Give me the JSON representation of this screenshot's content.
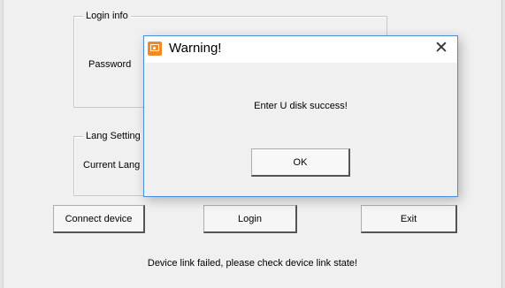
{
  "login_group": {
    "title": "Login info",
    "password_label": "Password"
  },
  "lang_group": {
    "title": "Lang Setting",
    "current_lang_label": "Current Lang"
  },
  "buttons": {
    "connect": "Connect device",
    "login": "Login",
    "exit": "Exit"
  },
  "status_text": "Device link failed, please check device link state!",
  "dialog": {
    "title": "Warning!",
    "message": "Enter U disk success!",
    "ok": "OK",
    "close_glyph": "✕"
  }
}
